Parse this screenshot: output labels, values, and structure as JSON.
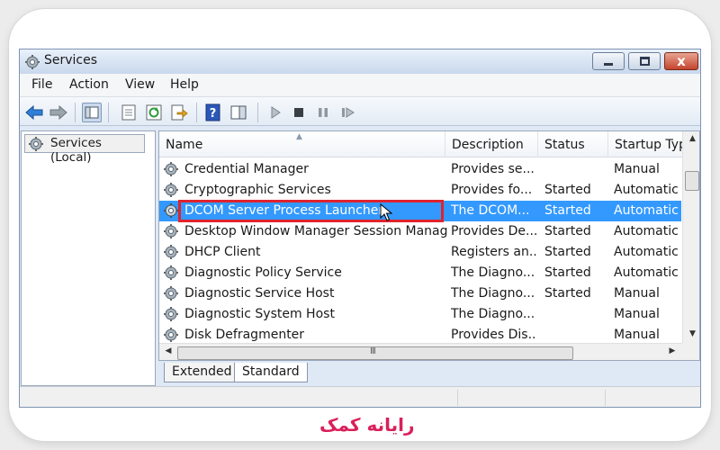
{
  "window": {
    "title": "Services",
    "controls": {
      "minimize": "minimize",
      "maximize": "maximize",
      "close": "x"
    }
  },
  "menu": [
    "File",
    "Action",
    "View",
    "Help"
  ],
  "toolbar": {
    "icons": [
      "back-arrow-icon",
      "forward-arrow-icon",
      "show-hide-console-tree-icon",
      "properties-icon",
      "refresh-icon",
      "export-list-icon",
      "help-icon",
      "show-hide-action-pane-icon",
      "start-service-icon",
      "stop-service-icon",
      "pause-service-icon",
      "restart-service-icon"
    ]
  },
  "tree": {
    "label": "Services (Local)"
  },
  "table": {
    "columns": [
      "Name",
      "Description",
      "Status",
      "Startup Typ"
    ],
    "rows": [
      {
        "name": "Credential Manager",
        "description": "Provides se...",
        "status": "",
        "startup": "Manual"
      },
      {
        "name": "Cryptographic Services",
        "description": "Provides fo...",
        "status": "Started",
        "startup": "Automatic"
      },
      {
        "name": "DCOM Server Process Launcher",
        "description": "The DCOM...",
        "status": "Started",
        "startup": "Automatic",
        "selected": true
      },
      {
        "name": "Desktop Window Manager Session Manager",
        "description": "Provides De...",
        "status": "Started",
        "startup": "Automatic"
      },
      {
        "name": "DHCP Client",
        "description": "Registers an...",
        "status": "Started",
        "startup": "Automatic"
      },
      {
        "name": "Diagnostic Policy Service",
        "description": "The Diagno...",
        "status": "Started",
        "startup": "Automatic"
      },
      {
        "name": "Diagnostic Service Host",
        "description": "The Diagno...",
        "status": "Started",
        "startup": "Manual"
      },
      {
        "name": "Diagnostic System Host",
        "description": "The Diagno...",
        "status": "",
        "startup": "Manual"
      },
      {
        "name": "Disk Defragmenter",
        "description": "Provides Dis...",
        "status": "",
        "startup": "Manual"
      }
    ],
    "scroll_grip": "III"
  },
  "tabs": [
    "Extended",
    "Standard"
  ],
  "branding": {
    "logo_text": "رایانه کمک"
  },
  "colors": {
    "selection": "#3399ff",
    "highlight_box": "#e0232e",
    "brand": "#d9205a"
  }
}
